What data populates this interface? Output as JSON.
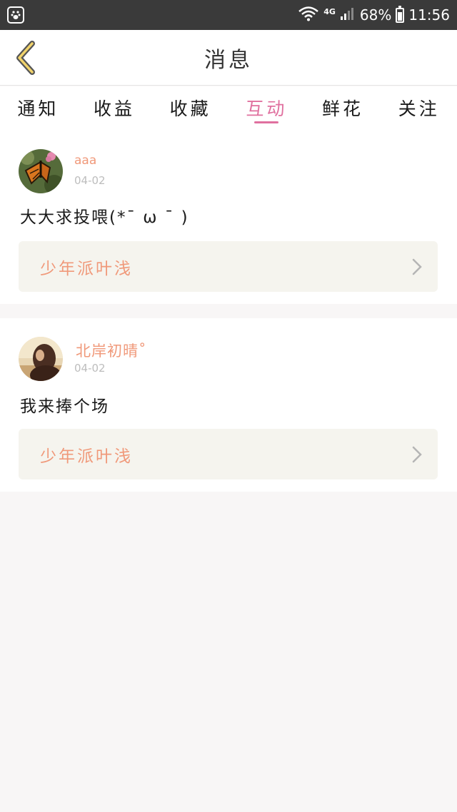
{
  "status_bar": {
    "network": "4G",
    "battery": "68%",
    "battery_level": 0.68,
    "time": "11:56"
  },
  "header": {
    "title": "消息"
  },
  "tabs": [
    {
      "label": "通知",
      "active": false
    },
    {
      "label": "收益",
      "active": false
    },
    {
      "label": "收藏",
      "active": false
    },
    {
      "label": "互动",
      "active": true
    },
    {
      "label": "鲜花",
      "active": false
    },
    {
      "label": "关注",
      "active": false
    }
  ],
  "messages": [
    {
      "username": "aaa",
      "date": "04-02",
      "comment": "大大求投喂(*¯ ω ¯ )",
      "work_title": "少年派叶浅"
    },
    {
      "username": "北岸初晴˚",
      "date": "04-02",
      "comment": "我来捧个场",
      "work_title": "少年派叶浅"
    }
  ],
  "colors": {
    "accent": "#e0709f",
    "name_color": "#f0997a",
    "status_bar": "#3a3a3a"
  }
}
